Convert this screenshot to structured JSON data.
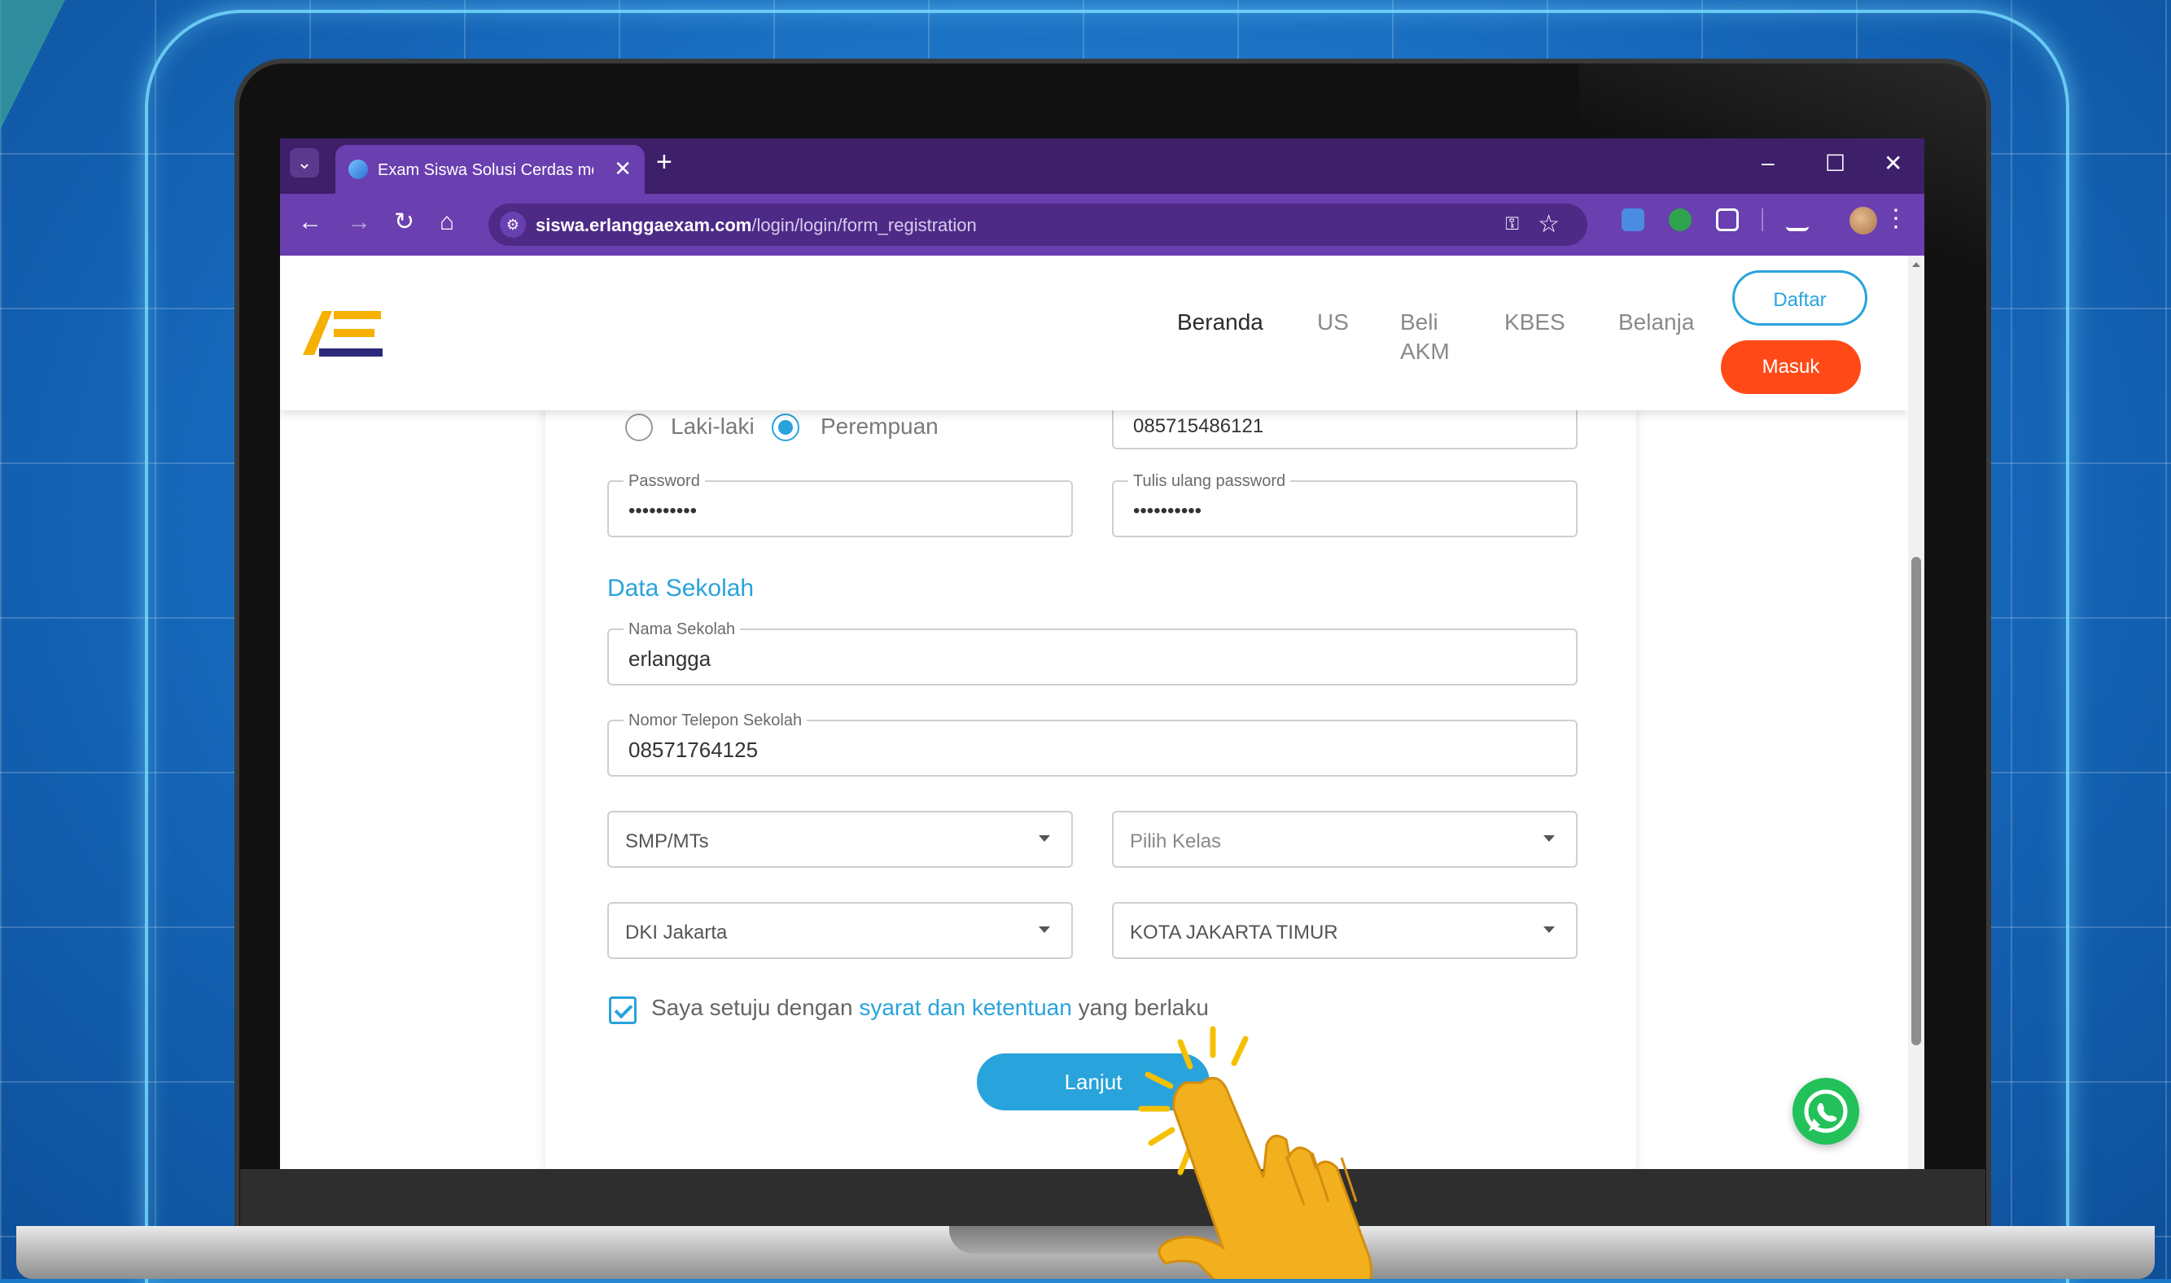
{
  "browser": {
    "tab_title": "Exam Siswa Solusi Cerdas mem",
    "url_domain": "siswa.erlanggaexam.com",
    "url_path": "/login/login/form_registration",
    "new_tab_symbol": "+",
    "tab_close_symbol": "✕"
  },
  "header": {
    "nav": [
      "Beranda",
      "US",
      "Beli",
      "AKM",
      "KBES",
      "Belanja"
    ],
    "daftar_label": "Daftar",
    "masuk_label": "Masuk"
  },
  "form": {
    "gender_options": [
      "Laki-laki",
      "Perempuan"
    ],
    "gender_selected": "Perempuan",
    "phone_value": "085715486121",
    "password_label": "Password",
    "password_value": "••••••••••",
    "repeat_password_label": "Tulis ulang password",
    "repeat_password_value": "••••••••••",
    "school_section_title": "Data Sekolah",
    "school_name_label": "Nama Sekolah",
    "school_name_value": "erlangga",
    "school_phone_label": "Nomor Telepon Sekolah",
    "school_phone_value": "08571764125",
    "level_value": "SMP/MTs",
    "class_placeholder": "Pilih Kelas",
    "province_value": "DKI Jakarta",
    "city_value": "KOTA JAKARTA TIMUR",
    "agree_prefix": "Saya setuju dengan",
    "agree_link": "syarat dan ketentuan",
    "agree_suffix": "yang berlaku",
    "agree_checked": true,
    "submit_label": "Lanjut"
  },
  "colors": {
    "accent": "#29a3dc",
    "masuk_button": "#ff4a17",
    "browser_chrome": "#6a3fb0",
    "whatsapp": "#23c15a"
  },
  "icons": [
    "tab-search-icon",
    "back-arrow-icon",
    "forward-arrow-icon",
    "reload-icon",
    "home-icon",
    "site-settings-icon",
    "password-key-icon",
    "bookmark-star-icon",
    "extensions-icon",
    "reading-list-icon",
    "profile-avatar-icon",
    "menu-kebab-icon",
    "whatsapp-icon",
    "pointing-hand-icon"
  ]
}
